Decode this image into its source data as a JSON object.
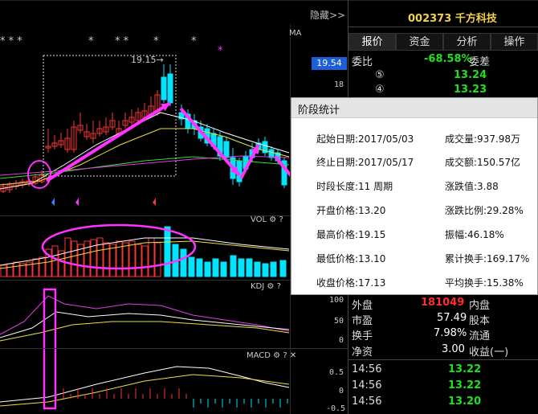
{
  "header": {
    "hide_label": "隐藏>>",
    "stock_code": "002373",
    "stock_name": "千方科技",
    "ma_label": "MA",
    "stars": [
      "* * *",
      "*",
      "* *",
      "*",
      "*",
      "*"
    ]
  },
  "tabs": [
    "报价",
    "资金",
    "分析",
    "操作"
  ],
  "quote": {
    "weibi_label": "委比",
    "weibi_value": "-68.58%",
    "weicha_label": "委差",
    "ask5_marker": "⑤",
    "ask5_price": "13.24",
    "ask4_marker": "④",
    "ask4_price": "13.23"
  },
  "price_axis": {
    "current_badge": "19.54",
    "tick_18": "18",
    "peak_label": "19.15→"
  },
  "popup": {
    "title": "阶段统计",
    "rows": [
      {
        "left": "起始日期:2017/05/03",
        "right": "成交量:937.98万"
      },
      {
        "left": "终止日期:2017/05/17",
        "right": "成交额:150.57亿"
      },
      {
        "left": "时段长度:11 周期",
        "right": "涨跌值:3.88"
      },
      {
        "left": "开盘价格:13.20",
        "right": "涨跌比例:29.28%"
      },
      {
        "left": "最高价格:19.15",
        "right": "振幅:46.18%"
      },
      {
        "left": "最低价格:13.10",
        "right": "累计换手:169.17%"
      },
      {
        "left": "收盘价格:17.13",
        "right": "平均换手:15.38%"
      }
    ]
  },
  "indicators": {
    "vol_label": "VOL",
    "kdj_label": "KDJ",
    "macd_label": "MACD",
    "gear": "⚙",
    "help": "?",
    "close": "✕",
    "kdj_axis": [
      "100",
      "50",
      "0"
    ],
    "macd_axis": [
      "0.5",
      "0",
      "-0.5"
    ]
  },
  "details": {
    "waipan_label": "外盘",
    "waipan_value": "181049",
    "neipan_label": "内盘",
    "shiying_label": "市盈",
    "shiying_value": "57.49",
    "guben_label": "股本",
    "huanshou_label": "换手",
    "huanshou_value": "7.98%",
    "liutong_label": "流通",
    "jingzi_label": "净资",
    "jingzi_value": "3.00",
    "shouyi_label": "收益(一)"
  },
  "trades": [
    {
      "time": "14:56",
      "price": "13.22"
    },
    {
      "time": "14:56",
      "price": "13.22"
    },
    {
      "time": "14:56",
      "price": "13.20"
    }
  ],
  "colors": {
    "up": "#ff3333",
    "down": "#00e5ff",
    "annotation": "#ff33ff",
    "green": "#1ee11e",
    "ma_white": "#ffffff",
    "ma_yellow": "#f0e040",
    "ma_green": "#33dd33",
    "ma_magenta": "#e040e0"
  }
}
